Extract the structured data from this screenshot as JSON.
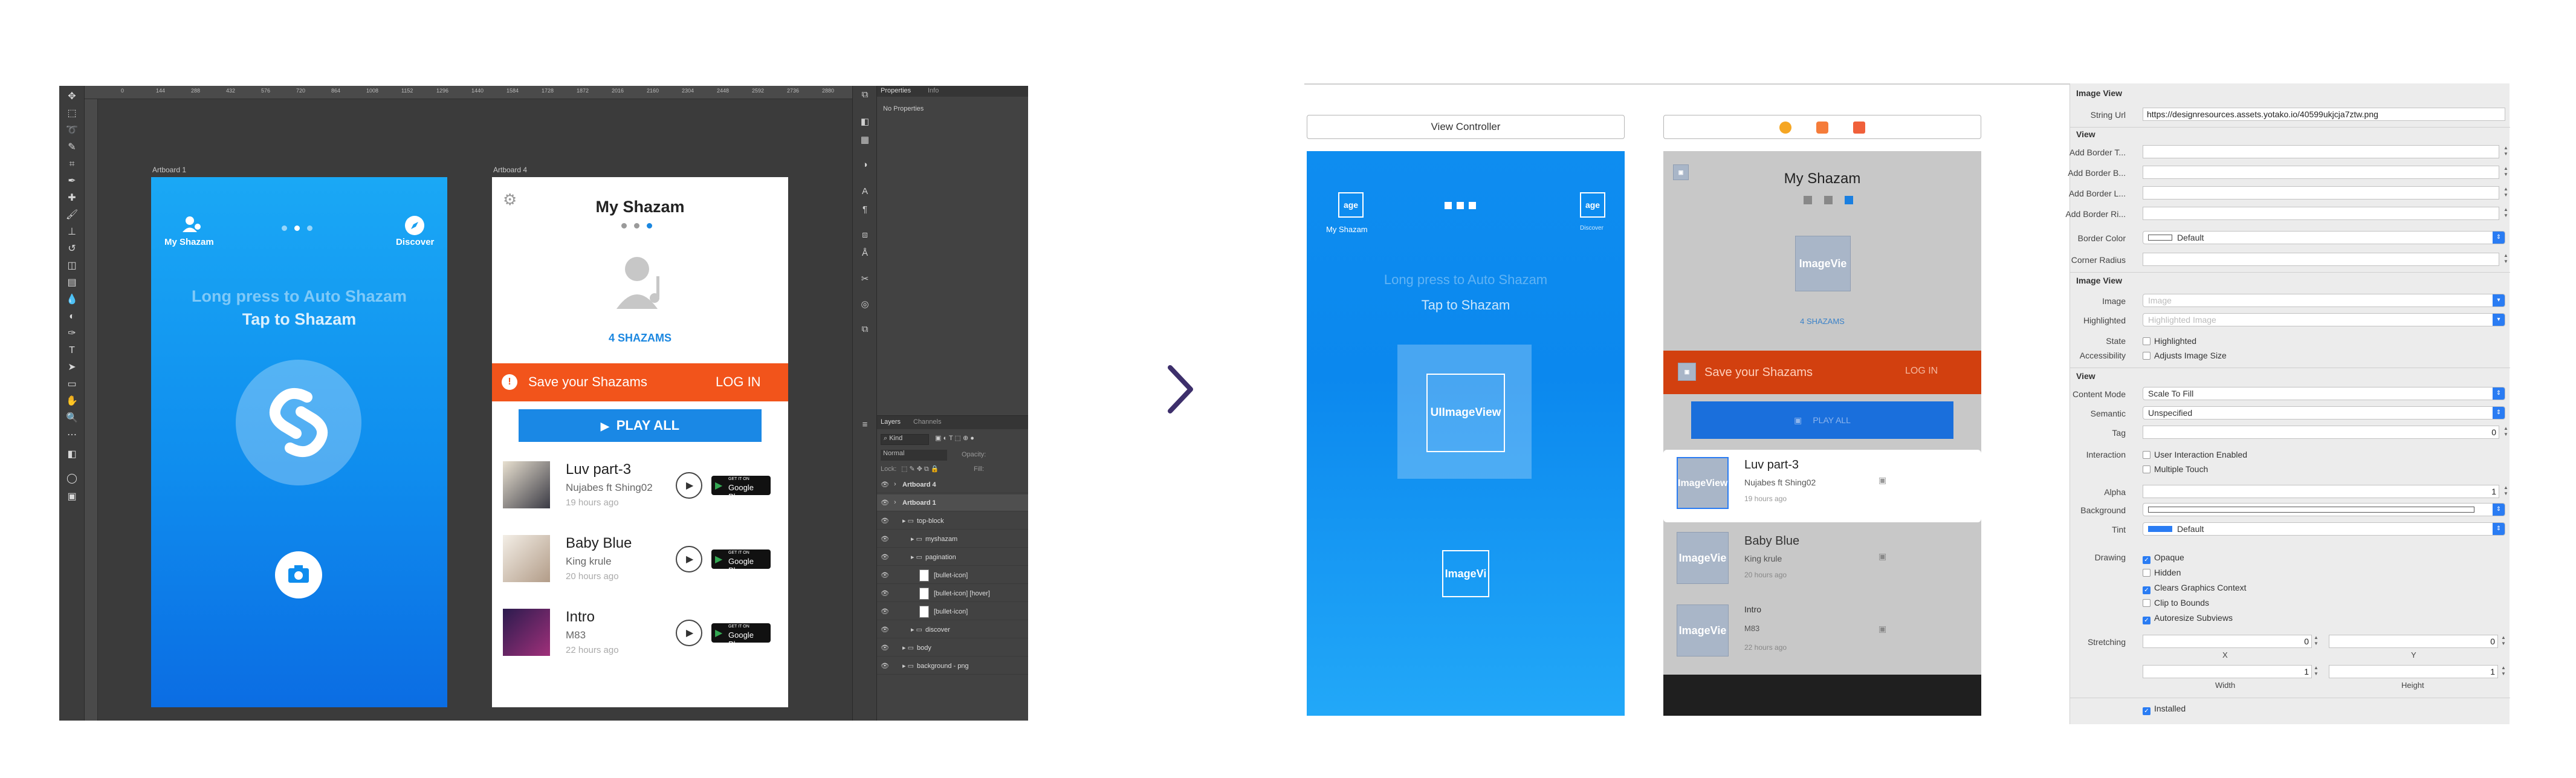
{
  "photoshop": {
    "ruler_ticks": [
      "0",
      "144",
      "288",
      "432",
      "576",
      "720",
      "864",
      "1008",
      "1152",
      "1296",
      "1440",
      "1584",
      "1728",
      "1872",
      "2016",
      "2160",
      "2304",
      "2448",
      "2592",
      "2736",
      "2880",
      "3024"
    ],
    "artboards": {
      "artboard1": {
        "label": "Artboard 1",
        "left_nav": "My Shazam",
        "right_nav": "Discover",
        "hint_line1": "Long press to Auto Shazam",
        "hint_line2": "Tap to Shazam",
        "page_dots": 3,
        "active_dot": 2
      },
      "artboard4": {
        "label": "Artboard 4",
        "title": "My Shazam",
        "count": "4 SHAZAMS",
        "banner_text": "Save your Shazams",
        "banner_action": "LOG IN",
        "play_all": "PLAY ALL",
        "page_dots": 3,
        "active_dot": 3,
        "store_badge_small": "GET IT ON",
        "store_badge": "Google Play",
        "tracks": [
          {
            "title": "Luv part-3",
            "artist": "Nujabes ft Shing02",
            "when": "19 hours ago"
          },
          {
            "title": "Baby Blue",
            "artist": "King krule",
            "when": "20 hours ago"
          },
          {
            "title": "Intro",
            "artist": "M83",
            "when": "22 hours ago"
          }
        ]
      }
    },
    "properties_tabs": [
      "Properties",
      "Info"
    ],
    "properties_empty": "No Properties",
    "layers_tabs": [
      "Layers",
      "Channels"
    ],
    "layers_filter": "Kind",
    "blend_mode": "Normal",
    "opacity_label": "Opacity:",
    "lock_label": "Lock:",
    "fill_label": "Fill:",
    "layers": [
      {
        "name": "Artboard 4",
        "indent": 0
      },
      {
        "name": "Artboard 1",
        "indent": 0
      },
      {
        "name": "top-block",
        "indent": 1
      },
      {
        "name": "myshazam",
        "indent": 2
      },
      {
        "name": "pagination",
        "indent": 2
      },
      {
        "name": "[bullet-icon]",
        "indent": 3
      },
      {
        "name": "[bullet-icon] [hover]",
        "indent": 3
      },
      {
        "name": "[bullet-icon]",
        "indent": 3
      },
      {
        "name": "discover",
        "indent": 2
      },
      {
        "name": "body",
        "indent": 1
      },
      {
        "name": "background - png",
        "indent": 1
      }
    ]
  },
  "xcode": {
    "scene1": {
      "header": "View Controller",
      "top_left_img": "age",
      "top_right_img": "age",
      "left_nav": "My Shazam",
      "right_nav": "Discover",
      "hint_line1": "Long press to Auto Shazam",
      "hint_line2": "Tap to Shazam",
      "main_image": "UIImageView",
      "bottom_image": "ImageVi"
    },
    "scene2": {
      "title": "My Shazam",
      "image": "ImageVie",
      "count": "4 SHAZAMS",
      "banner_text": "Save your Shazams",
      "banner_action": "LOG IN",
      "play_all": "PLAY ALL",
      "rows": [
        {
          "img": "ImageView",
          "title": "Luv part-3",
          "artist": "Nujabes ft Shing02",
          "when": "19 hours ago"
        },
        {
          "img": "ImageVie",
          "title": "Baby Blue",
          "artist": "King krule",
          "when": "20 hours ago"
        },
        {
          "img": "ImageVie",
          "title": "Intro",
          "artist": "M83",
          "when": "22 hours ago"
        }
      ]
    },
    "inspector": {
      "image_view_title": "Image View",
      "string_url_label": "String Url",
      "string_url": "https://designresources.assets.yotako.io/40599ukjcja7ztw.png",
      "view_title": "View",
      "border_labels": [
        "Add Border T...",
        "Add Border B...",
        "Add Border L...",
        "Add Border Ri..."
      ],
      "border_color_label": "Border Color",
      "border_color_value": "Default",
      "corner_radius_label": "Corner Radius",
      "image_view_title2": "Image View",
      "image_label": "Image",
      "image_placeholder": "Image",
      "highlighted_label": "Highlighted",
      "highlighted_placeholder": "Highlighted Image",
      "state_label": "State",
      "state_check": "Highlighted",
      "accessibility_label": "Accessibility",
      "accessibility_check": "Adjusts Image Size",
      "view_title2": "View",
      "content_mode_label": "Content Mode",
      "content_mode_value": "Scale To Fill",
      "semantic_label": "Semantic",
      "semantic_value": "Unspecified",
      "tag_label": "Tag",
      "tag_value": "0",
      "interaction_label": "Interaction",
      "interaction_checks": [
        "User Interaction Enabled",
        "Multiple Touch"
      ],
      "alpha_label": "Alpha",
      "alpha_value": "1",
      "background_label": "Background",
      "tint_label": "Tint",
      "tint_value": "Default",
      "drawing_label": "Drawing",
      "drawing_checks": [
        {
          "label": "Opaque",
          "on": true
        },
        {
          "label": "Hidden",
          "on": false
        },
        {
          "label": "Clears Graphics Context",
          "on": true
        },
        {
          "label": "Clip to Bounds",
          "on": false
        },
        {
          "label": "Autoresize Subviews",
          "on": true
        }
      ],
      "stretching_label": "Stretching",
      "stretch_x": "0",
      "stretch_y": "0",
      "x_label": "X",
      "y_label": "Y",
      "stretch_w": "1",
      "stretch_h": "1",
      "width_label": "Width",
      "height_label": "Height",
      "installed_label": "Installed"
    },
    "colors": {
      "brand_blue": "#0f8dee",
      "banner_orange": "#f2541b",
      "xcode_banner": "#d2400f",
      "play_blue": "#1a88e5",
      "selection_blue": "#2a7cf3"
    }
  }
}
